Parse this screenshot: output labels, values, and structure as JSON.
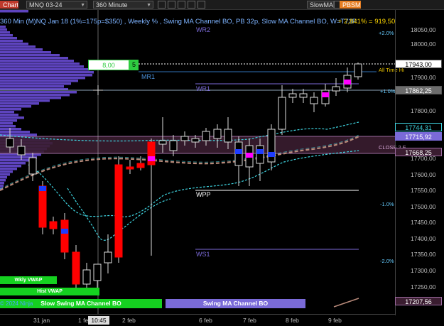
{
  "toolbar": {
    "chart_tab": "Chart",
    "instrument": "MNQ 03-24",
    "period": "360 Minute",
    "indicator1": "SlowMA",
    "indicator2": "PBSMA"
  },
  "header": {
    "title": "360 Min (M)NQ Jan 18 (1%=175p=$350) , Weekly % , Swing MA Channel BO, PB 32p, Slow MA Channel BO, W=T73P",
    "profit": "+ 2,841% = 919,50"
  },
  "order_entry": {
    "quantity": "8,00",
    "button": "5"
  },
  "price_axis": {
    "ticks": [
      "18050,00",
      "18000,00",
      "17900,00",
      "17800,00",
      "17700,00",
      "17600,00",
      "17550,00",
      "17500,00",
      "17450,00",
      "17400,00",
      "17350,00",
      "17300,00",
      "17250,00"
    ],
    "labels": {
      "last": "17943,00",
      "wr1": "17862,25",
      "upper": "17744,31",
      "mid": "17715,92",
      "lower": "17668,25",
      "bottom": "17207,56"
    }
  },
  "levels": {
    "wr2": "WR2",
    "mr1": "MR1",
    "wr1": "WR1",
    "wpp": "WPP",
    "ws1": "WS1",
    "all_time_high": "All Time Hi",
    "close": "CLOSE 2 F"
  },
  "percent_labels": {
    "p2": "+2.0%",
    "p1": "+1.0%",
    "m1": "-1.0%",
    "m2": "-2.0%"
  },
  "buttons": {
    "wkly_vwap": "Wkly VWAP",
    "hist_vwap": "Hist VWAP",
    "slow_swing": "Slow Swing MA Channel BO",
    "swing": "Swing MA Channel BO"
  },
  "copyright": "© 2024 Ninja",
  "time_axis": {
    "dates": [
      "31 jan",
      "1 feb",
      "2 feb",
      "6 feb",
      "7 feb",
      "8 feb",
      "9 feb"
    ],
    "cursor_time": "10:45"
  },
  "colors": {
    "bull_candle": "#ffffff",
    "bear_candle": "#ff0000",
    "signal_blue": "#1e3cff",
    "signal_magenta": "#ff00ff",
    "channel_cyan": "#3fd4e0",
    "ma_tan": "#b88a7a",
    "volume_profile": "#6e50e0",
    "green_button": "#15d120",
    "purple_button": "#7a6ad8"
  }
}
